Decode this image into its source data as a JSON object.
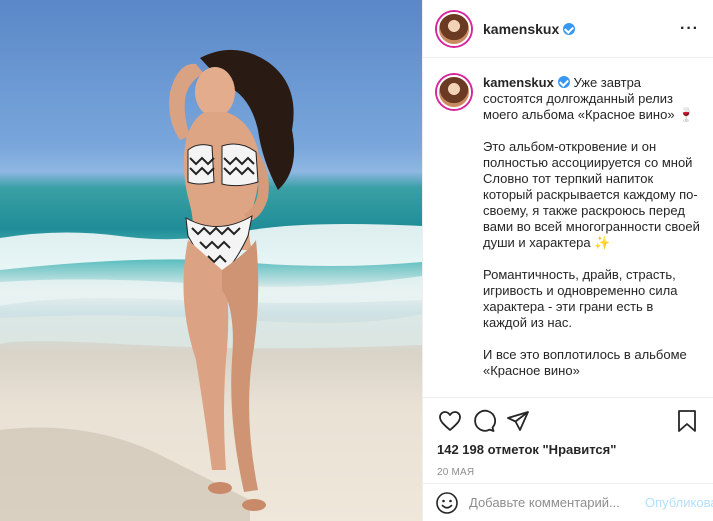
{
  "post": {
    "photo_alt": "",
    "colors": {
      "accent": "#3897f0",
      "publish_disabled": "#b2dffc",
      "muted": "#8e8e8e",
      "border": "#efefef"
    }
  },
  "header": {
    "username": "kamenskux",
    "verified": true,
    "more_icon": "more-horizontal-icon",
    "more_label": "···"
  },
  "caption": {
    "username": "kamenskux",
    "text": " Уже завтра состоятся долгожданный релиз моего альбома «Красное вино» 🍷\n\nЭто альбом-откровение и он полностью ассоциируется со мной Словно тот терпкий напиток который раскрывается каждому по-своему, я также раскроюсь перед вами во всей многогранности своей души и характера ✨\n\nРомантичность, драйв, страсть, игривость и одновременно сила характера - эти грани есть в каждой из нас.\n\nИ все это воплотилось в альбоме «Красное вино»"
  },
  "actions": {
    "like_icon": "heart-icon",
    "comment_icon": "comment-icon",
    "share_icon": "paper-plane-icon",
    "save_icon": "bookmark-icon",
    "likes_text": "142 198 отметок \"Нравится\"",
    "date": "20 МАЯ"
  },
  "comment": {
    "emoji_icon": "smiley-icon",
    "placeholder": "Добавьте комментарий...",
    "value": "",
    "publish_label": "Опубликовать"
  }
}
